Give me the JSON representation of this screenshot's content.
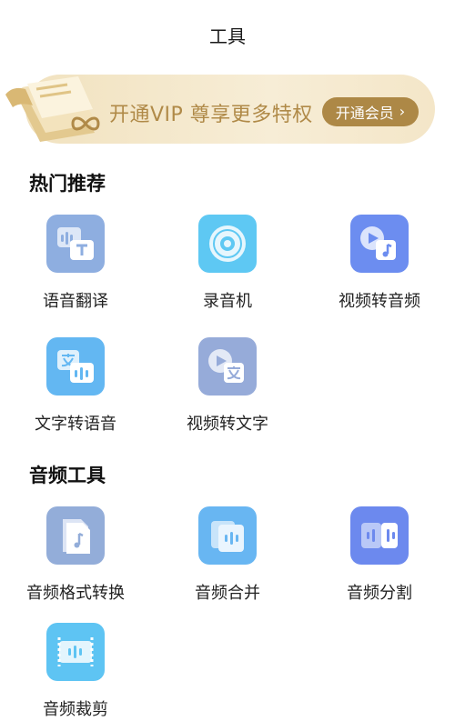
{
  "header": {
    "title": "工具"
  },
  "vip": {
    "text": "开通VIP 尊享更多特权",
    "button_label": "开通会员"
  },
  "sections": {
    "hot": {
      "title": "热门推荐",
      "items": [
        {
          "label": "语音翻译",
          "icon": "voice-translate-icon",
          "color": "#8eaee0"
        },
        {
          "label": "录音机",
          "icon": "recorder-icon",
          "color": "#5ec8f3"
        },
        {
          "label": "视频转音频",
          "icon": "video-to-audio-icon",
          "color": "#6c8df0"
        },
        {
          "label": "文字转语音",
          "icon": "text-to-speech-icon",
          "color": "#63b7f2"
        },
        {
          "label": "视频转文字",
          "icon": "video-to-text-icon",
          "color": "#96abd9"
        }
      ]
    },
    "audio": {
      "title": "音频工具",
      "items": [
        {
          "label": "音频格式转换",
          "icon": "audio-format-convert-icon",
          "color": "#93add9"
        },
        {
          "label": "音频合并",
          "icon": "audio-merge-icon",
          "color": "#68b6f2"
        },
        {
          "label": "音频分割",
          "icon": "audio-split-icon",
          "color": "#6c89ee"
        },
        {
          "label": "音频裁剪",
          "icon": "audio-trim-icon",
          "color": "#5ec4f3"
        }
      ]
    }
  }
}
